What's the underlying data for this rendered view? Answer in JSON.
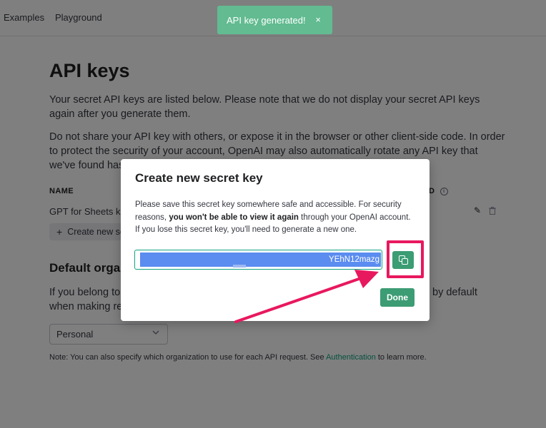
{
  "nav": {
    "examples": "Examples",
    "playground": "Playground"
  },
  "page": {
    "title": "API keys",
    "intro": "Your secret API keys are listed below. Please note that we do not display your secret API keys again after you generate them.",
    "warning": "Do not share your API key with others, or expose it in the browser or other client-side code. In order to protect the security of your account, OpenAI may also automatically rotate any API key that we've found has leaked publicly.",
    "table_header_name": "NAME",
    "table_header_right": "D",
    "key_row_name": "GPT for Sheets ke",
    "create_button": "Create new se",
    "org_heading": "Default organ",
    "org_text_left": "If you belong to",
    "org_text_left2": "when making rec",
    "org_text_right": "by default",
    "org_select": "Personal",
    "note_prefix": "Note: You can also specify which organization to use for each API request. See ",
    "note_link": "Authentication",
    "note_suffix": " to learn more."
  },
  "toast": {
    "text": "API key generated!",
    "close": "×"
  },
  "modal": {
    "title": "Create new secret key",
    "text_part1": "Please save this secret key somewhere safe and accessible. For security reasons, ",
    "text_bold": "you won't be able to view it again",
    "text_part2": " through your OpenAI account. If you lose this secret key, you'll need to generate a new one.",
    "key_visible": "YEhN12mazg",
    "done": "Done"
  },
  "icons": {
    "edit": "pencil-icon",
    "delete": "trash-icon",
    "info": "info-icon",
    "copy": "copy-icon",
    "chevron": "chevron-down-icon",
    "plus": "plus-icon"
  },
  "colors": {
    "accent": "#10a37f",
    "button": "#3c9c74",
    "toast": "#62bb91",
    "highlight": "#e8185f"
  }
}
